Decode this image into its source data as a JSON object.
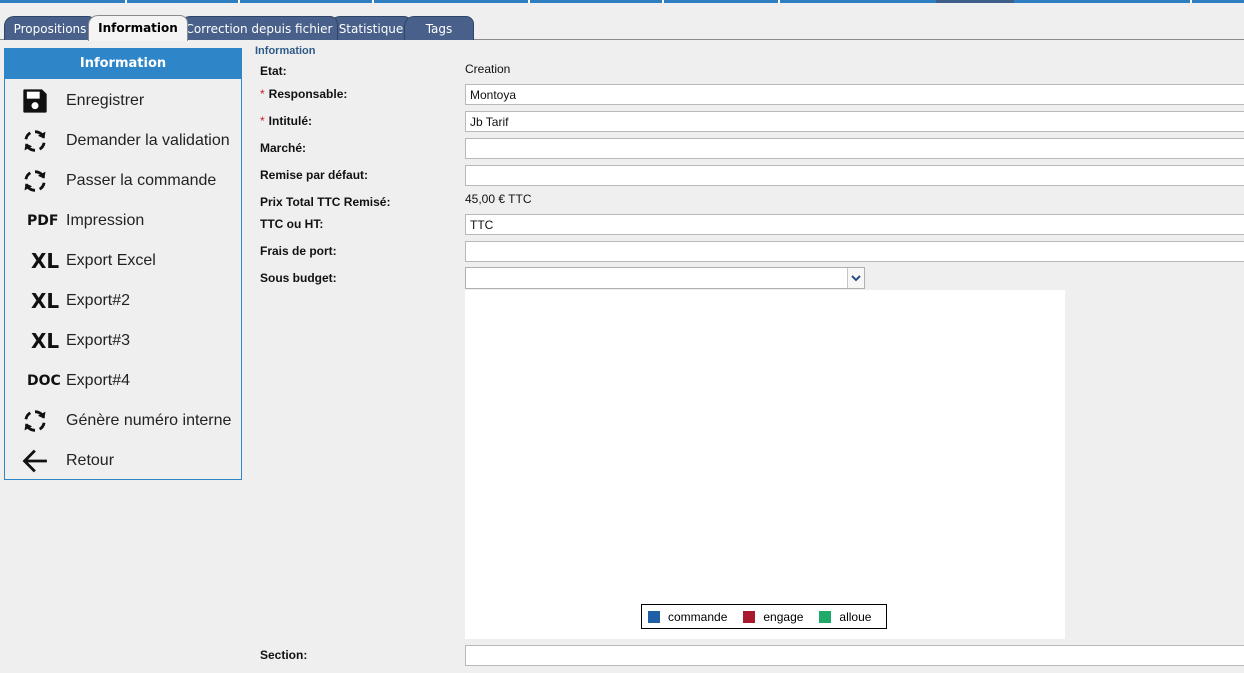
{
  "tabs": [
    {
      "label": "Propositions",
      "active": false
    },
    {
      "label": "Information",
      "active": true
    },
    {
      "label": "Correction depuis fichier",
      "active": false
    },
    {
      "label": "Statistique",
      "active": false
    },
    {
      "label": "Tags",
      "active": false
    }
  ],
  "menu": {
    "header": "Information",
    "items": [
      {
        "label": "Enregistrer",
        "icon": "floppy-disk-icon"
      },
      {
        "label": "Demander la validation",
        "icon": "refresh-icon"
      },
      {
        "label": "Passer la commande",
        "icon": "refresh-icon"
      },
      {
        "label": "Impression",
        "icon": "pdf-icon",
        "icon_text": "PDF"
      },
      {
        "label": "Export Excel",
        "icon": "excel-icon",
        "icon_text": "XL"
      },
      {
        "label": "Export#2",
        "icon": "excel-icon",
        "icon_text": "XL"
      },
      {
        "label": "Export#3",
        "icon": "excel-icon",
        "icon_text": "XL"
      },
      {
        "label": "Export#4",
        "icon": "doc-icon",
        "icon_text": "DOC"
      },
      {
        "label": "Génère numéro interne",
        "icon": "refresh-icon"
      },
      {
        "label": "Retour",
        "icon": "arrow-left-icon"
      }
    ]
  },
  "form": {
    "section_title": "Information",
    "etat": {
      "label": "Etat:",
      "value": "Creation"
    },
    "responsable": {
      "label": "Responsable:",
      "value": "Montoya",
      "required": true
    },
    "intitule": {
      "label": "Intitulé:",
      "value": "Jb Tarif",
      "required": true
    },
    "marche": {
      "label": "Marché:",
      "value": ""
    },
    "remise": {
      "label": "Remise par défaut:",
      "value": ""
    },
    "prix_total": {
      "label": "Prix Total TTC Remisé:",
      "value": "45,00 € TTC"
    },
    "ttc_ht": {
      "label": "TTC ou HT:",
      "value": "TTC"
    },
    "frais_port": {
      "label": "Frais de port:",
      "value": ""
    },
    "sous_budget": {
      "label": "Sous budget:",
      "value": ""
    },
    "section": {
      "label": "Section:",
      "value": ""
    },
    "required_mark": "*"
  },
  "chart_data": {
    "type": "bar",
    "series": [
      {
        "name": "commande",
        "color": "#1f5fa6",
        "values": []
      },
      {
        "name": "engage",
        "color": "#a8192e",
        "values": []
      },
      {
        "name": "alloue",
        "color": "#1faa6a",
        "values": []
      }
    ],
    "legend_position": "bottom"
  },
  "colors": {
    "accent": "#2e86c8",
    "tab": "#48608a",
    "section_title": "#2c5a88",
    "required": "#c81e1e"
  }
}
